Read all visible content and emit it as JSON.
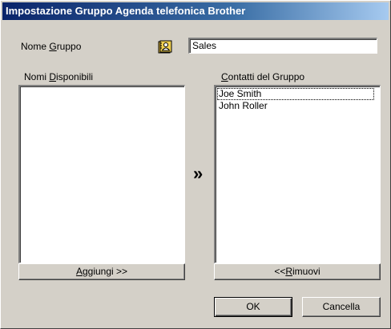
{
  "window": {
    "title": "Impostazione Gruppo Agenda telefonica Brother"
  },
  "group_name": {
    "label_pre": "Nome ",
    "label_accel": "G",
    "label_post": "ruppo",
    "value": "Sales"
  },
  "available_names": {
    "label_pre": "Nomi ",
    "label_accel": "D",
    "label_post": "isponibili",
    "items": []
  },
  "group_contacts": {
    "label_pre": "",
    "label_accel": "C",
    "label_post": "ontatti del Gruppo",
    "items": [
      "Joe Smith",
      "John Roller"
    ]
  },
  "buttons": {
    "add_accel": "A",
    "add_rest": "ggiungi >>",
    "remove_pre": "<< ",
    "remove_accel": "R",
    "remove_rest": "imuovi",
    "ok": "OK",
    "cancel": "Cancella"
  },
  "transfer_arrow": "»",
  "icons": {
    "address_book": "address-book-icon"
  }
}
